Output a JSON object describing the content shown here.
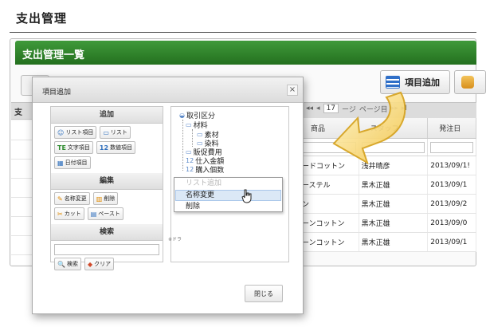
{
  "page": {
    "title": "支出管理"
  },
  "panel": {
    "header": "支出管理一覧",
    "strip_label": "支"
  },
  "toolbar": {
    "add_item_label": "項目追加"
  },
  "pager": {
    "first": "◂◂",
    "prev": "◂",
    "page": "17",
    "page_suffix": "ージ",
    "page_of": "ページ目",
    "next": "▸▸",
    "last": "▸I"
  },
  "grid": {
    "columns": [
      "商品",
      "スタッフ",
      "発注日"
    ],
    "rows": [
      [
        "ードコットン",
        "浅井晴彦",
        "2013/09/1!"
      ],
      [
        "ーステル",
        "黒木正雄",
        "2013/09/1"
      ],
      [
        "ン",
        "黒木正雄",
        "2013/09/2"
      ],
      [
        "ーンコットン",
        "黒木正雄",
        "2013/09/0"
      ],
      [
        "ーンコットン",
        "黒木正雄",
        "2013/09/1"
      ]
    ]
  },
  "modal": {
    "title": "項目追加",
    "close_x": "×",
    "sections": {
      "add": {
        "header": "追加",
        "buttons": [
          {
            "name": "list-item-button",
            "glyph": "☺",
            "label": "リスト項目"
          },
          {
            "name": "list-button",
            "glyph": "▭",
            "label": "リスト"
          },
          {
            "name": "text-item-button",
            "glyph": "TE",
            "label": "文字項目"
          },
          {
            "name": "number-item-button",
            "glyph": "12",
            "label": "数値項目"
          },
          {
            "name": "date-item-button",
            "glyph": "▦",
            "label": "日付項目"
          }
        ]
      },
      "edit": {
        "header": "編集",
        "buttons": [
          {
            "name": "rename-button",
            "glyph": "✎",
            "label": "名称変更"
          },
          {
            "name": "delete-button",
            "glyph": "▥",
            "label": "削除"
          },
          {
            "name": "cut-button",
            "glyph": "✂",
            "label": "カット"
          },
          {
            "name": "paste-button",
            "glyph": "▤",
            "label": "ペースト"
          }
        ]
      },
      "search": {
        "header": "検索",
        "input_value": "",
        "buttons": [
          {
            "name": "search-button",
            "glyph": "🔍",
            "label": "検索"
          },
          {
            "name": "clear-button",
            "glyph": "◆",
            "label": "クリア"
          }
        ]
      }
    },
    "tree": {
      "root": "取引区分",
      "material": "材料",
      "material_child_1": "素材",
      "material_child_2": "染料",
      "promo": "販促費用",
      "purchase_amount": "仕入金額",
      "purchase_count": "購入個数"
    },
    "drop_note": "※ドラ",
    "context_menu": {
      "items": [
        "リスト追加",
        "名称変更",
        "削除"
      ],
      "hovered": "名称変更"
    },
    "close_button": "閉じる"
  }
}
